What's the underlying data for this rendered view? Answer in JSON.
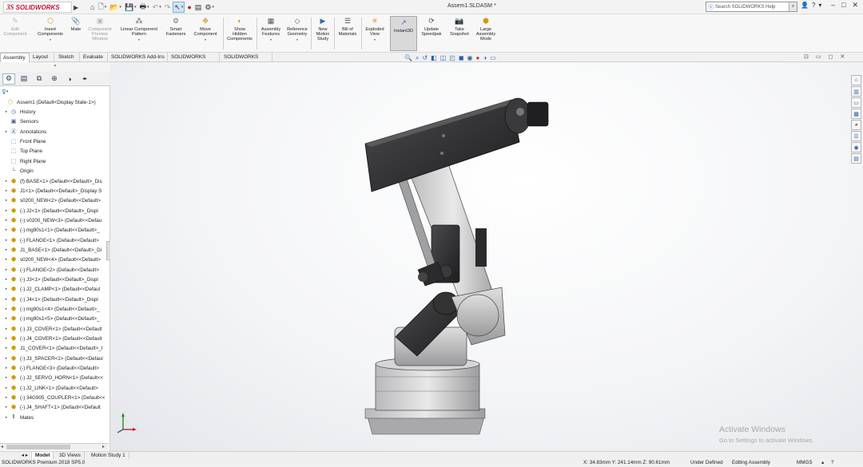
{
  "app": {
    "logo_ds": "3S",
    "logo_text": "SOLIDWORKS",
    "document_title": "Assem1.SLDASM *",
    "help_search_placeholder": "Search SOLIDWORKS Help",
    "help_label": "?"
  },
  "command_manager": {
    "commands": [
      {
        "label": "Edit\nComponent",
        "icon": "edit-component-icon",
        "enabled": false
      },
      {
        "label": "Insert\nComponents",
        "icon": "insert-components-icon",
        "enabled": true
      },
      {
        "label": "Mate",
        "icon": "mate-icon",
        "enabled": true
      },
      {
        "label": "Component\nPreview\nWindow",
        "icon": "preview-window-icon",
        "enabled": false
      },
      {
        "label": "Linear Component\nPattern",
        "icon": "linear-pattern-icon",
        "enabled": true
      },
      {
        "label": "Smart\nFasteners",
        "icon": "smart-fasteners-icon",
        "enabled": true
      },
      {
        "label": "Move\nComponent",
        "icon": "move-component-icon",
        "enabled": true
      },
      {
        "label": "Show\nHidden\nComponents",
        "icon": "show-hidden-icon",
        "enabled": true
      },
      {
        "label": "Assembly\nFeatures",
        "icon": "assembly-features-icon",
        "enabled": true
      },
      {
        "label": "Reference\nGeometry",
        "icon": "reference-geometry-icon",
        "enabled": true
      },
      {
        "label": "New\nMotion\nStudy",
        "icon": "motion-study-icon",
        "enabled": true
      },
      {
        "label": "Bill of\nMaterials",
        "icon": "bom-icon",
        "enabled": true
      },
      {
        "label": "Exploded\nView",
        "icon": "exploded-view-icon",
        "enabled": true
      },
      {
        "label": "Instant3D",
        "icon": "instant3d-icon",
        "enabled": true,
        "active": true
      },
      {
        "label": "Update\nSpeedpak",
        "icon": "speedpak-icon",
        "enabled": true
      },
      {
        "label": "Take\nSnapshot",
        "icon": "snapshot-icon",
        "enabled": true
      },
      {
        "label": "Large\nAssembly\nMode",
        "icon": "large-assembly-icon",
        "enabled": true
      }
    ]
  },
  "tabs": [
    "Assembly",
    "Layout",
    "Sketch",
    "Evaluate",
    "SOLIDWORKS Add-Ins",
    "SOLIDWORKS MBD",
    "SOLIDWORKS CAM"
  ],
  "active_tab": "Assembly",
  "tree": {
    "root": "Assem1  (Default<Display State-1>)",
    "items": [
      {
        "label": "History",
        "icon": "history-icon"
      },
      {
        "label": "Sensors",
        "icon": "sensors-icon"
      },
      {
        "label": "Annotations",
        "icon": "annotations-icon"
      },
      {
        "label": "Front Plane",
        "icon": "plane-icon"
      },
      {
        "label": "Top Plane",
        "icon": "plane-icon"
      },
      {
        "label": "Right Plane",
        "icon": "plane-icon"
      },
      {
        "label": "Origin",
        "icon": "origin-icon"
      },
      {
        "label": "(f) BASE<1> (Default<<Default>_Dis",
        "icon": "part-icon"
      },
      {
        "label": "J1<1> (Default<<Default>_Display S",
        "icon": "part-icon"
      },
      {
        "label": "s0200_NEW<2> (Default<<Default>",
        "icon": "part-icon"
      },
      {
        "label": "(-) J2<1> (Default<<Default>_Displ",
        "icon": "part-icon"
      },
      {
        "label": "(-) s0200_NEW<3> (Default<<Defau",
        "icon": "part-icon"
      },
      {
        "label": "(-) mg90s1<1> (Default<<Default>_",
        "icon": "part-icon"
      },
      {
        "label": "(-) FLANGE<1> (Default<<Default>",
        "icon": "part-icon"
      },
      {
        "label": "J1_BASE<1> (Default<<Default>_Di",
        "icon": "part-icon"
      },
      {
        "label": "s0200_NEW<4> (Default<<Default>",
        "icon": "part-icon"
      },
      {
        "label": "(-) FLANGE<2> (Default<<Default>",
        "icon": "part-icon"
      },
      {
        "label": "(-) J3<1> (Default<<Default>_Displ",
        "icon": "part-icon"
      },
      {
        "label": "(-) J2_CLAMP<1> (Default<<Defaul",
        "icon": "part-icon"
      },
      {
        "label": "(-) J4<1> (Default<<Default>_Displ",
        "icon": "part-icon"
      },
      {
        "label": "(-) mg90s1<4> (Default<<Default>_",
        "icon": "part-icon"
      },
      {
        "label": "(-) mg90s1<5> (Default<<Default>_",
        "icon": "part-icon"
      },
      {
        "label": "(-) J3_COVER<1> (Default<<Default",
        "icon": "part-icon"
      },
      {
        "label": "(-) J4_COVER<1> (Default<<Default",
        "icon": "part-icon"
      },
      {
        "label": "J1_COVER<1> (Default<<Default>_I",
        "icon": "part-icon"
      },
      {
        "label": "(-) J3_SPACER<1> (Default<<Defaul",
        "icon": "part-icon"
      },
      {
        "label": "(-) FLANGE<3> (Default<<Default>",
        "icon": "part-icon"
      },
      {
        "label": "(-) J2_SERVO_HORN<1> (Default<<",
        "icon": "part-icon"
      },
      {
        "label": "(-) J2_LINK<1> (Default<<Default>",
        "icon": "part-icon"
      },
      {
        "label": "(-) 34G905_COUPLER<1> (Default<<",
        "icon": "part-icon"
      },
      {
        "label": "(-) J4_SHAFT<1> (Default<<Default",
        "icon": "part-icon"
      },
      {
        "label": "Mates",
        "icon": "mates-icon"
      }
    ]
  },
  "bottom_tabs": [
    "Model",
    "3D Views",
    "Motion Study 1"
  ],
  "active_bottom_tab": "Model",
  "watermark": {
    "line1": "Activate Windows",
    "line2": "Go to Settings to activate Windows."
  },
  "status": {
    "product": "SOLIDWORKS Premium 2018 SP5.0",
    "coordinates": "X: 34.83mm Y: 241.14mm Z: 90.61mm",
    "definition": "Under Defined",
    "mode": "Editing Assembly",
    "units": "MMGS"
  },
  "colors": {
    "accent": "#c8102e",
    "link": "#2a5fa8",
    "part_icon": "#d39a00"
  }
}
